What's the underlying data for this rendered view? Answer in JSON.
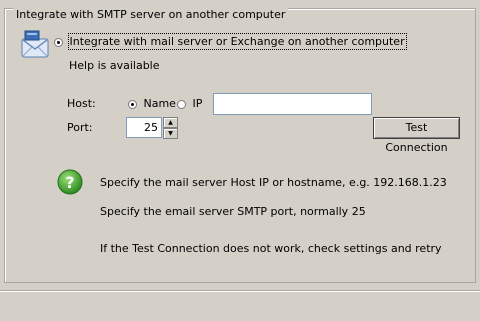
{
  "group": {
    "title": "Integrate with SMTP server on another computer"
  },
  "option": {
    "label": "Integrate with mail server or Exchange on another computer",
    "selected": true
  },
  "help_available": "Help is available",
  "host": {
    "label": "Host:",
    "name_option": "Name",
    "ip_option": "IP",
    "selected": "Name",
    "value": ""
  },
  "port": {
    "label": "Port:",
    "value": "25"
  },
  "test_button": "Test Connection",
  "help_lines": [
    "Specify the mail server Host IP or hostname, e.g. 192.168.1.23",
    "Specify the email server SMTP port, normally 25",
    "If the Test Connection does not work, check settings and retry"
  ],
  "icons": {
    "mail": "mail-server-icon",
    "help": "help-question-icon"
  },
  "colors": {
    "background": "#d4d0c8",
    "help_icon_green": "#3a9a2a",
    "field_border": "#7f9db9"
  }
}
